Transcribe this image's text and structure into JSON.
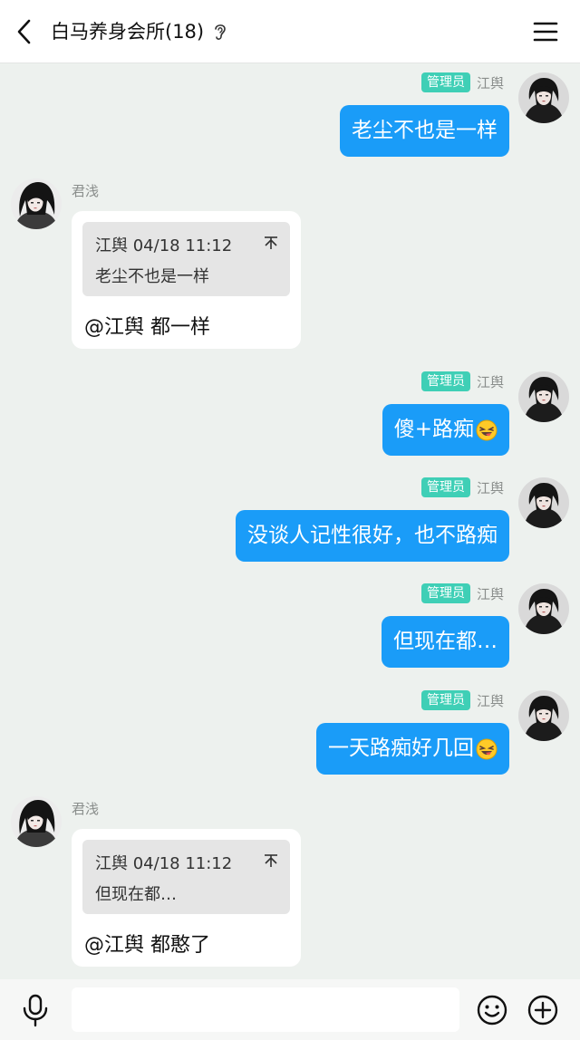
{
  "header": {
    "title": "白马养身会所(18)",
    "back_icon": "chevron-left-icon",
    "ear_icon": "ear-icon",
    "menu_icon": "hamburger-menu-icon"
  },
  "messages": [
    {
      "side": "right",
      "badge": "管理员",
      "sender": "江舆",
      "text": "老尘不也是一样"
    },
    {
      "side": "left",
      "sender": "君浅",
      "quote_header": "江舆 04/18 11:12",
      "quote_text": "老尘不也是一样",
      "text": "@江舆 都一样"
    },
    {
      "side": "right",
      "badge": "管理员",
      "sender": "江舆",
      "text": "傻+路痴",
      "emoji": "laughing-face-emoji"
    },
    {
      "side": "right",
      "badge": "管理员",
      "sender": "江舆",
      "text": "没谈人记性很好，也不路痴"
    },
    {
      "side": "right",
      "badge": "管理员",
      "sender": "江舆",
      "text": "但现在都…"
    },
    {
      "side": "right",
      "badge": "管理员",
      "sender": "江舆",
      "text": "一天路痴好几回",
      "emoji": "laughing-face-emoji"
    },
    {
      "side": "left",
      "sender": "君浅",
      "quote_header": "江舆 04/18 11:12",
      "quote_text": "但现在都…",
      "text": "@江舆 都憨了"
    }
  ],
  "input": {
    "value": "",
    "placeholder": "",
    "mic_icon": "microphone-icon",
    "emoji_icon": "smiley-icon",
    "plus_icon": "plus-circle-icon"
  },
  "colors": {
    "background": "#edf1ee",
    "bubble_right": "#1a9cf8",
    "admin_badge": "#3fcfb6",
    "bubble_left": "#ffffff"
  }
}
